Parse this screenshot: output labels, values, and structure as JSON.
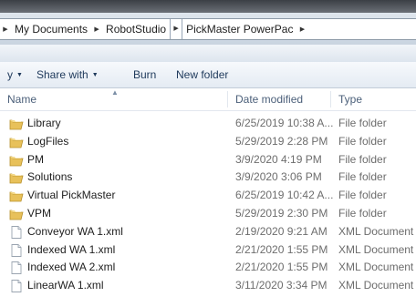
{
  "address_bar": {
    "crumbs": [
      "My Documents",
      "RobotStudio",
      "PickMaster PowerPac"
    ]
  },
  "toolbar": {
    "organize_partial": "y",
    "share_label": "Share with",
    "burn_label": "Burn",
    "new_folder_label": "New folder"
  },
  "columns": {
    "name": "Name",
    "date": "Date modified",
    "type": "Type"
  },
  "files": [
    {
      "name": "Library",
      "date": "6/25/2019 10:38 A...",
      "type": "File folder",
      "icon": "folder-icon"
    },
    {
      "name": "LogFiles",
      "date": "5/29/2019 2:28 PM",
      "type": "File folder",
      "icon": "folder-icon"
    },
    {
      "name": "PM",
      "date": "3/9/2020 4:19 PM",
      "type": "File folder",
      "icon": "folder-icon"
    },
    {
      "name": "Solutions",
      "date": "3/9/2020 3:06 PM",
      "type": "File folder",
      "icon": "folder-icon"
    },
    {
      "name": "Virtual PickMaster",
      "date": "6/25/2019 10:42 A...",
      "type": "File folder",
      "icon": "folder-icon"
    },
    {
      "name": "VPM",
      "date": "5/29/2019 2:30 PM",
      "type": "File folder",
      "icon": "folder-icon"
    },
    {
      "name": "Conveyor WA 1.xml",
      "date": "2/19/2020 9:21 AM",
      "type": "XML Document",
      "icon": "document-icon"
    },
    {
      "name": "Indexed WA 1.xml",
      "date": "2/21/2020 1:55 PM",
      "type": "XML Document",
      "icon": "document-icon"
    },
    {
      "name": "Indexed WA 2.xml",
      "date": "2/21/2020 1:55 PM",
      "type": "XML Document",
      "icon": "document-icon"
    },
    {
      "name": "LinearWA 1.xml",
      "date": "3/11/2020 3:34 PM",
      "type": "XML Document",
      "icon": "document-icon"
    }
  ],
  "colors": {
    "toolbar_text": "#1e395b",
    "header_text": "#4c607a",
    "meta_text": "#6d6d6d",
    "folder_yellow": "#e8c15a"
  }
}
